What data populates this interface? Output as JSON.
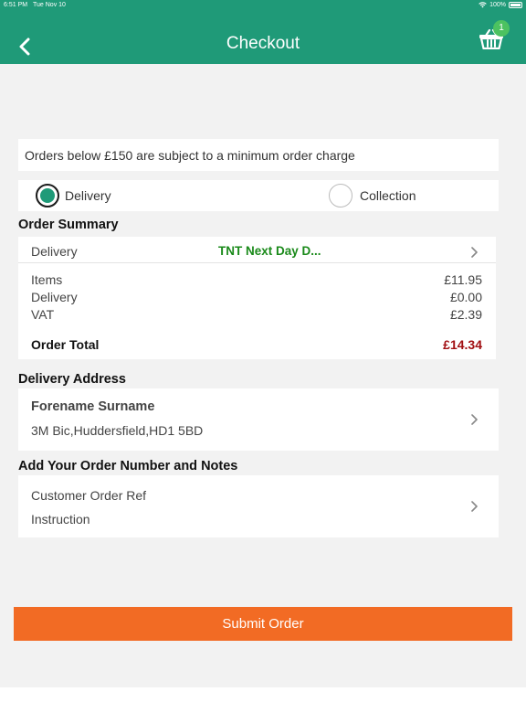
{
  "status_bar": {
    "time": "6:51 PM",
    "date": "Tue Nov 10",
    "battery": "100%"
  },
  "header": {
    "title": "Checkout",
    "basket_count": "1"
  },
  "notice": {
    "text": "Orders below £150 are subject to a minimum order charge"
  },
  "delivery_type": {
    "options": [
      {
        "label": "Delivery",
        "selected": true
      },
      {
        "label": "Collection",
        "selected": false
      }
    ]
  },
  "order_summary": {
    "heading": "Order Summary",
    "shipping_label": "Delivery",
    "shipping_value": "TNT Next Day D...",
    "lines": [
      {
        "label": "Items",
        "value": "£11.95"
      },
      {
        "label": "Delivery",
        "value": "£0.00"
      },
      {
        "label": "VAT",
        "value": "£2.39"
      }
    ],
    "total_label": "Order Total",
    "total_value": "£14.34"
  },
  "delivery_address": {
    "heading": "Delivery Address",
    "name": "Forename Surname",
    "address": "3M Bic,Huddersfield,HD1 5BD"
  },
  "order_notes": {
    "heading": "Add Your Order Number and Notes",
    "customer_ref_label": "Customer Order Ref",
    "instruction_label": "Instruction"
  },
  "submit": {
    "label": "Submit Order"
  },
  "colors": {
    "header": "#1f9a78",
    "badge": "#4cc260",
    "shipping_text": "#1a8a1a",
    "total_text": "#a10f12",
    "submit_button": "#f26b24"
  }
}
